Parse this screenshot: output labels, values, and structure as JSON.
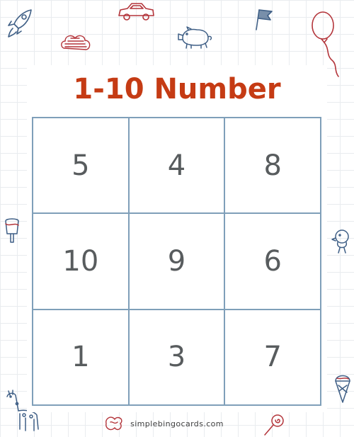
{
  "title": "1-10 Number",
  "grid": [
    [
      "5",
      "4",
      "8"
    ],
    [
      "10",
      "9",
      "6"
    ],
    [
      "1",
      "3",
      "7"
    ]
  ],
  "footer": "simplebingocards.com",
  "colors": {
    "title": "#c53b14",
    "grid_line": "#7f9fb9",
    "number": "#585c5e",
    "doodle_blue": "#3f5f86",
    "doodle_red": "#b3343a"
  },
  "doodles": [
    "rocket-icon",
    "car-icon",
    "flag-icon",
    "balloon-icon",
    "cloud-icon",
    "pig-icon",
    "popsicle-icon",
    "chick-icon",
    "ice-cream-icon",
    "giraffe-icon",
    "scribble-icon",
    "lollipop-icon"
  ]
}
